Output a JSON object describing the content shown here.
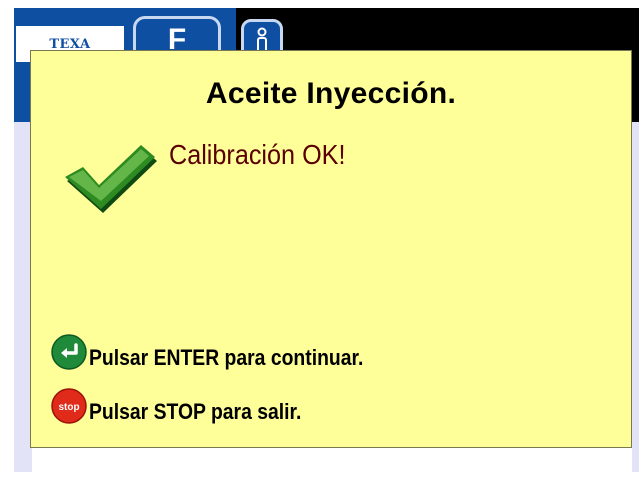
{
  "header": {
    "logo_text": "TEXA",
    "key_tab_label": "F"
  },
  "dialog": {
    "title": "Aceite Inyección.",
    "status": "Calibración OK!",
    "status_icon": "checkmark-icon",
    "instructions": [
      {
        "icon": "enter-icon",
        "label": "Pulsar ENTER para continuar."
      },
      {
        "icon": "stop-icon",
        "label": "Pulsar STOP para salir."
      }
    ]
  },
  "colors": {
    "dialog_bg": "#ffff99",
    "status_text": "#5a0000",
    "header_blue": "#0f4fa2",
    "check_green": "#2e8b22",
    "stop_red": "#e02a1a",
    "enter_green": "#1f8a3a"
  }
}
